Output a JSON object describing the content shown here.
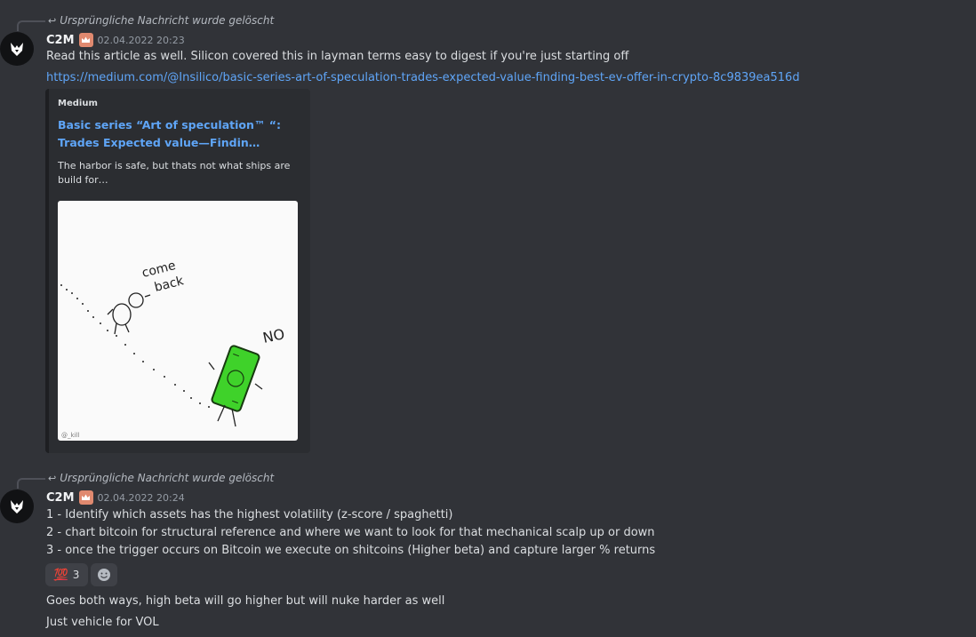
{
  "messages": [
    {
      "reply_text": "Ursprüngliche Nachricht wurde gelöscht",
      "author": "C2M",
      "timestamp": "02.04.2022 20:23",
      "lines": [
        "Read this article as well. Silicon covered this in layman terms easy to digest if you're just starting off"
      ],
      "link": "https://medium.com/@Insilico/basic-series-art-of-speculation-trades-expected-value-finding-best-ev-offer-in-crypto-8c9839ea516d",
      "embed": {
        "provider": "Medium",
        "title": "Basic series “Art of speculation™ “: Trades Expected value—Findin…",
        "description": "The harbor is safe, but thats not what ships are build for…",
        "image_text_1": "come",
        "image_text_2": "back",
        "image_text_3": "NO",
        "image_signature": "@_kill"
      }
    },
    {
      "reply_text": "Ursprüngliche Nachricht wurde gelöscht",
      "author": "C2M",
      "timestamp": "02.04.2022 20:24",
      "lines": [
        "1 - Identify which assets has the highest volatility (z-score / spaghetti)",
        "2 - chart bitcoin for structural reference and where we want to look for that mechanical scalp up or down",
        "3 - once the trigger occurs on Bitcoin we execute on shitcoins (Higher beta) and capture larger % returns"
      ],
      "reactions": [
        {
          "emoji": "💯",
          "count": "3",
          "icon": "hundred-points-icon"
        },
        {
          "emoji": "",
          "count": "",
          "icon": "add-reaction-icon"
        }
      ],
      "followups": [
        "Goes both ways, high beta will go higher but will nuke harder as well",
        "Just vehicle for VOL"
      ]
    }
  ],
  "colors": {
    "background": "#313338",
    "link": "#5fa5f7",
    "embed_bg": "#2b2d31",
    "role_badge": "#e0896f"
  }
}
